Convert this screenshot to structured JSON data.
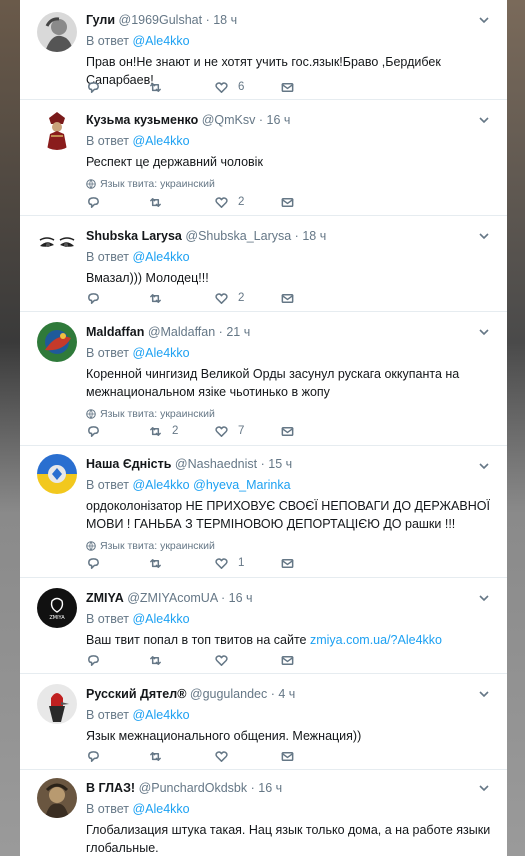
{
  "tweets": [
    {
      "name": "Гули",
      "handle": "@1969Gulshat",
      "time": "18 ч",
      "reply_prefix": "В ответ",
      "reply_to": "@Ale4kko",
      "reply_to_2": "",
      "text": "Прав он!Не знают и не хотят учить гос.язык!Браво ,Бердибек Сапарбаев!",
      "link": "",
      "lang": "",
      "counts": {
        "reply": "",
        "retweet": "",
        "like": "6"
      }
    },
    {
      "name": "Кузьма кузьменко",
      "handle": "@QmKsv",
      "time": "16 ч",
      "reply_prefix": "В ответ",
      "reply_to": "@Ale4kko",
      "reply_to_2": "",
      "text": "Респект це державний чоловік",
      "link": "",
      "lang": "Язык твита: украинский",
      "counts": {
        "reply": "",
        "retweet": "",
        "like": "2"
      }
    },
    {
      "name": "Shubska Larysa",
      "handle": "@Shubska_Larysa",
      "time": "18 ч",
      "reply_prefix": "В ответ",
      "reply_to": "@Ale4kko",
      "reply_to_2": "",
      "text": "Вмазал))) Молодец!!!",
      "link": "",
      "lang": "",
      "counts": {
        "reply": "",
        "retweet": "",
        "like": "2"
      }
    },
    {
      "name": "Maldaffan",
      "handle": "@Maldaffan",
      "time": "21 ч",
      "reply_prefix": "В ответ",
      "reply_to": "@Ale4kko",
      "reply_to_2": "",
      "text": "Коренной чингизид Великой Орды засунул рускага оккупанта на межнациональном язіке чьотинько в жопу",
      "link": "",
      "lang": "Язык твита: украинский",
      "counts": {
        "reply": "",
        "retweet": "2",
        "like": "7"
      }
    },
    {
      "name": "Наша Єдність",
      "handle": "@Nashaednist",
      "time": "15 ч",
      "reply_prefix": "В ответ",
      "reply_to": "@Ale4kko",
      "reply_to_2": "@hyeva_Marinka",
      "text": "ордоколонізатор НЕ ПРИХОВУЄ СВОЄЇ НЕПОВАГИ ДО ДЕРЖАВНОЇ МОВИ ! ГАНЬБА З ТЕРМІНОВОЮ ДЕПОРТАЦІЄЮ ДО рашки !!!",
      "link": "",
      "lang": "Язык твита: украинский",
      "counts": {
        "reply": "",
        "retweet": "",
        "like": "1"
      }
    },
    {
      "name": "ZMIYA",
      "handle": "@ZMIYAcomUA",
      "time": "16 ч",
      "reply_prefix": "В ответ",
      "reply_to": "@Ale4kko",
      "reply_to_2": "",
      "text": "Ваш твит попал в топ твитов на сайте ",
      "link": "zmiya.com.ua/?Ale4kko",
      "lang": "",
      "counts": {
        "reply": "",
        "retweet": "",
        "like": ""
      }
    },
    {
      "name": "Русский Дятел®",
      "handle": "@gugulandec",
      "time": "4 ч",
      "reply_prefix": "В ответ",
      "reply_to": "@Ale4kko",
      "reply_to_2": "",
      "text": "Язык межнационального общения. Межнация))",
      "link": "",
      "lang": "",
      "counts": {
        "reply": "",
        "retweet": "",
        "like": ""
      }
    },
    {
      "name": "В ГЛАЗ!",
      "handle": "@PunchardOkdsbk",
      "time": "16 ч",
      "reply_prefix": "В ответ",
      "reply_to": "@Ale4kko",
      "reply_to_2": "",
      "text": "Глобализация штука такая. Нац язык только дома,  а на работе языки глобальные.",
      "link": "",
      "lang": "",
      "counts": {
        "reply": "",
        "retweet": "",
        "like": ""
      }
    }
  ],
  "colors": {
    "accent": "#1da1f2",
    "muted": "#657786",
    "text": "#14171a",
    "border": "#e6ecf0"
  },
  "icons": [
    "caret-down-icon",
    "reply-icon",
    "retweet-icon",
    "like-icon",
    "direct-message-icon",
    "globe-icon"
  ]
}
